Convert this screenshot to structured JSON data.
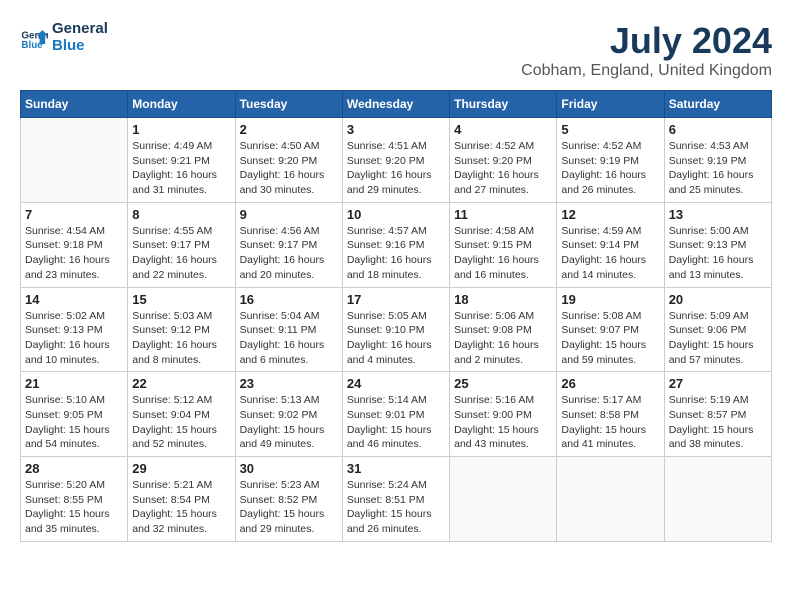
{
  "logo": {
    "line1": "General",
    "line2": "Blue"
  },
  "title": "July 2024",
  "location": "Cobham, England, United Kingdom",
  "days_of_week": [
    "Sunday",
    "Monday",
    "Tuesday",
    "Wednesday",
    "Thursday",
    "Friday",
    "Saturday"
  ],
  "weeks": [
    [
      {
        "day": "",
        "sunrise": "",
        "sunset": "",
        "daylight": ""
      },
      {
        "day": "1",
        "sunrise": "Sunrise: 4:49 AM",
        "sunset": "Sunset: 9:21 PM",
        "daylight": "Daylight: 16 hours and 31 minutes."
      },
      {
        "day": "2",
        "sunrise": "Sunrise: 4:50 AM",
        "sunset": "Sunset: 9:20 PM",
        "daylight": "Daylight: 16 hours and 30 minutes."
      },
      {
        "day": "3",
        "sunrise": "Sunrise: 4:51 AM",
        "sunset": "Sunset: 9:20 PM",
        "daylight": "Daylight: 16 hours and 29 minutes."
      },
      {
        "day": "4",
        "sunrise": "Sunrise: 4:52 AM",
        "sunset": "Sunset: 9:20 PM",
        "daylight": "Daylight: 16 hours and 27 minutes."
      },
      {
        "day": "5",
        "sunrise": "Sunrise: 4:52 AM",
        "sunset": "Sunset: 9:19 PM",
        "daylight": "Daylight: 16 hours and 26 minutes."
      },
      {
        "day": "6",
        "sunrise": "Sunrise: 4:53 AM",
        "sunset": "Sunset: 9:19 PM",
        "daylight": "Daylight: 16 hours and 25 minutes."
      }
    ],
    [
      {
        "day": "7",
        "sunrise": "Sunrise: 4:54 AM",
        "sunset": "Sunset: 9:18 PM",
        "daylight": "Daylight: 16 hours and 23 minutes."
      },
      {
        "day": "8",
        "sunrise": "Sunrise: 4:55 AM",
        "sunset": "Sunset: 9:17 PM",
        "daylight": "Daylight: 16 hours and 22 minutes."
      },
      {
        "day": "9",
        "sunrise": "Sunrise: 4:56 AM",
        "sunset": "Sunset: 9:17 PM",
        "daylight": "Daylight: 16 hours and 20 minutes."
      },
      {
        "day": "10",
        "sunrise": "Sunrise: 4:57 AM",
        "sunset": "Sunset: 9:16 PM",
        "daylight": "Daylight: 16 hours and 18 minutes."
      },
      {
        "day": "11",
        "sunrise": "Sunrise: 4:58 AM",
        "sunset": "Sunset: 9:15 PM",
        "daylight": "Daylight: 16 hours and 16 minutes."
      },
      {
        "day": "12",
        "sunrise": "Sunrise: 4:59 AM",
        "sunset": "Sunset: 9:14 PM",
        "daylight": "Daylight: 16 hours and 14 minutes."
      },
      {
        "day": "13",
        "sunrise": "Sunrise: 5:00 AM",
        "sunset": "Sunset: 9:13 PM",
        "daylight": "Daylight: 16 hours and 13 minutes."
      }
    ],
    [
      {
        "day": "14",
        "sunrise": "Sunrise: 5:02 AM",
        "sunset": "Sunset: 9:13 PM",
        "daylight": "Daylight: 16 hours and 10 minutes."
      },
      {
        "day": "15",
        "sunrise": "Sunrise: 5:03 AM",
        "sunset": "Sunset: 9:12 PM",
        "daylight": "Daylight: 16 hours and 8 minutes."
      },
      {
        "day": "16",
        "sunrise": "Sunrise: 5:04 AM",
        "sunset": "Sunset: 9:11 PM",
        "daylight": "Daylight: 16 hours and 6 minutes."
      },
      {
        "day": "17",
        "sunrise": "Sunrise: 5:05 AM",
        "sunset": "Sunset: 9:10 PM",
        "daylight": "Daylight: 16 hours and 4 minutes."
      },
      {
        "day": "18",
        "sunrise": "Sunrise: 5:06 AM",
        "sunset": "Sunset: 9:08 PM",
        "daylight": "Daylight: 16 hours and 2 minutes."
      },
      {
        "day": "19",
        "sunrise": "Sunrise: 5:08 AM",
        "sunset": "Sunset: 9:07 PM",
        "daylight": "Daylight: 15 hours and 59 minutes."
      },
      {
        "day": "20",
        "sunrise": "Sunrise: 5:09 AM",
        "sunset": "Sunset: 9:06 PM",
        "daylight": "Daylight: 15 hours and 57 minutes."
      }
    ],
    [
      {
        "day": "21",
        "sunrise": "Sunrise: 5:10 AM",
        "sunset": "Sunset: 9:05 PM",
        "daylight": "Daylight: 15 hours and 54 minutes."
      },
      {
        "day": "22",
        "sunrise": "Sunrise: 5:12 AM",
        "sunset": "Sunset: 9:04 PM",
        "daylight": "Daylight: 15 hours and 52 minutes."
      },
      {
        "day": "23",
        "sunrise": "Sunrise: 5:13 AM",
        "sunset": "Sunset: 9:02 PM",
        "daylight": "Daylight: 15 hours and 49 minutes."
      },
      {
        "day": "24",
        "sunrise": "Sunrise: 5:14 AM",
        "sunset": "Sunset: 9:01 PM",
        "daylight": "Daylight: 15 hours and 46 minutes."
      },
      {
        "day": "25",
        "sunrise": "Sunrise: 5:16 AM",
        "sunset": "Sunset: 9:00 PM",
        "daylight": "Daylight: 15 hours and 43 minutes."
      },
      {
        "day": "26",
        "sunrise": "Sunrise: 5:17 AM",
        "sunset": "Sunset: 8:58 PM",
        "daylight": "Daylight: 15 hours and 41 minutes."
      },
      {
        "day": "27",
        "sunrise": "Sunrise: 5:19 AM",
        "sunset": "Sunset: 8:57 PM",
        "daylight": "Daylight: 15 hours and 38 minutes."
      }
    ],
    [
      {
        "day": "28",
        "sunrise": "Sunrise: 5:20 AM",
        "sunset": "Sunset: 8:55 PM",
        "daylight": "Daylight: 15 hours and 35 minutes."
      },
      {
        "day": "29",
        "sunrise": "Sunrise: 5:21 AM",
        "sunset": "Sunset: 8:54 PM",
        "daylight": "Daylight: 15 hours and 32 minutes."
      },
      {
        "day": "30",
        "sunrise": "Sunrise: 5:23 AM",
        "sunset": "Sunset: 8:52 PM",
        "daylight": "Daylight: 15 hours and 29 minutes."
      },
      {
        "day": "31",
        "sunrise": "Sunrise: 5:24 AM",
        "sunset": "Sunset: 8:51 PM",
        "daylight": "Daylight: 15 hours and 26 minutes."
      },
      {
        "day": "",
        "sunrise": "",
        "sunset": "",
        "daylight": ""
      },
      {
        "day": "",
        "sunrise": "",
        "sunset": "",
        "daylight": ""
      },
      {
        "day": "",
        "sunrise": "",
        "sunset": "",
        "daylight": ""
      }
    ]
  ]
}
